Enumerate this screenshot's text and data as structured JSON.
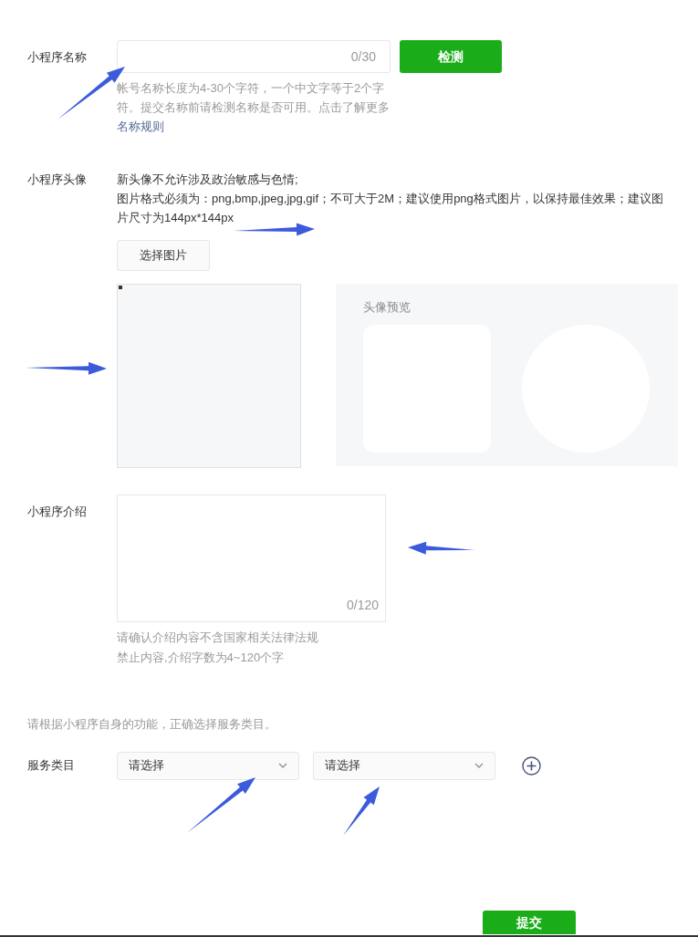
{
  "name_section": {
    "label": "小程序名称",
    "counter": "0/30",
    "check_button": "检测",
    "hint": "帐号名称长度为4-30个字符，一个中文字等于2个字符。提交名称前请检测名称是否可用。点击了解更多",
    "hint_link": "名称规则"
  },
  "avatar_section": {
    "label": "小程序头像",
    "notes": [
      "新头像不允许涉及政治敏感与色情;",
      "图片格式必须为：png,bmp,jpeg,jpg,gif；不可大于2M；建议使用png格式图片，以保持最佳效果；建议图片尺寸为144px*144px"
    ],
    "choose_button": "选择图片",
    "preview_title": "头像预览"
  },
  "intro_section": {
    "label": "小程序介绍",
    "counter": "0/120",
    "hints": [
      "请确认介绍内容不含国家相关法律法规",
      "禁止内容,介绍字数为4~120个字"
    ]
  },
  "category_section": {
    "tip": "请根据小程序自身的功能，正确选择服务类目。",
    "label": "服务类目",
    "selects": [
      "请选择",
      "请选择"
    ]
  },
  "submit_button": "提交"
}
